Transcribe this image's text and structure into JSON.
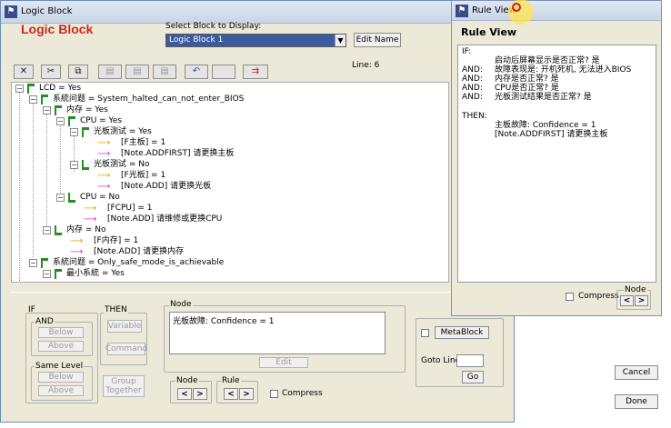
{
  "window": {
    "title": "Logic Block",
    "app_title": "Logic Block"
  },
  "select": {
    "label": "Select Block to Display:",
    "value": "Logic Block 1",
    "edit_name": "Edit Name"
  },
  "toolbar": {
    "line_label": "Line: 6"
  },
  "tree": [
    {
      "label": "LCD = Yes"
    },
    {
      "label": "系統问题 = System_halted_can_not_enter_BIOS"
    },
    {
      "label": "内存 = Yes"
    },
    {
      "label": "CPU = Yes"
    },
    {
      "label": "光板测试 = Yes"
    },
    {
      "label": "[F主板] = 1"
    },
    {
      "label": "[Note.ADDFIRST] 请更换主板"
    },
    {
      "label": "光板测试 = No"
    },
    {
      "label": "[F光板] = 1"
    },
    {
      "label": "[Note.ADD] 请更换光板"
    },
    {
      "label": "CPU = No"
    },
    {
      "label": "[FCPU] = 1"
    },
    {
      "label": "[Note.ADD] 请维修或更换CPU"
    },
    {
      "label": "内存 = No"
    },
    {
      "label": "[F内存] = 1"
    },
    {
      "label": "[Note.ADD] 请更换内存"
    },
    {
      "label": "系統问题 = Only_safe_mode_is_achievable"
    },
    {
      "label": "最小系統 = Yes"
    }
  ],
  "bottom": {
    "if_label": "IF",
    "and_label": "AND",
    "same_level_label": "Same Level",
    "below": "Below",
    "above": "Above",
    "then_label": "THEN",
    "variable": "Variable",
    "command": "Command",
    "group_together_1": "Group",
    "group_together_2": "Together",
    "node_label": "Node",
    "node_text": "光板故障: Confidence = 1",
    "edit": "Edit",
    "node_nav_label": "Node",
    "rule_nav_label": "Rule",
    "prev": "<",
    "next": ">",
    "compress": "Compress",
    "metablock": "MetaBlock",
    "goto_line": "Goto Line:",
    "go": "Go",
    "cancel": "Cancel",
    "done": "Done"
  },
  "rule_view": {
    "window_title": "Rule View",
    "heading": "Rule View",
    "lines": [
      {
        "kw": "IF:",
        "text": ""
      },
      {
        "kw": "",
        "text": "启动后屏幕显示是否正常? 是"
      },
      {
        "kw": "AND:",
        "text": "故障表现是: 开机死机, 无法进入BIOS"
      },
      {
        "kw": "AND:",
        "text": "内存是否正常? 是"
      },
      {
        "kw": "AND:",
        "text": "CPU是否正常? 是"
      },
      {
        "kw": "AND:",
        "text": "光板测试结果是否正常? 是"
      },
      {
        "kw": "",
        "text": ""
      },
      {
        "kw": "THEN:",
        "text": ""
      },
      {
        "kw": "",
        "text": "主板故障: Confidence = 1"
      },
      {
        "kw": "",
        "text": "[Note.ADDFIRST] 请更换主板"
      }
    ],
    "compress": "Compress",
    "node_label": "Node",
    "prev": "<",
    "next": ">"
  }
}
